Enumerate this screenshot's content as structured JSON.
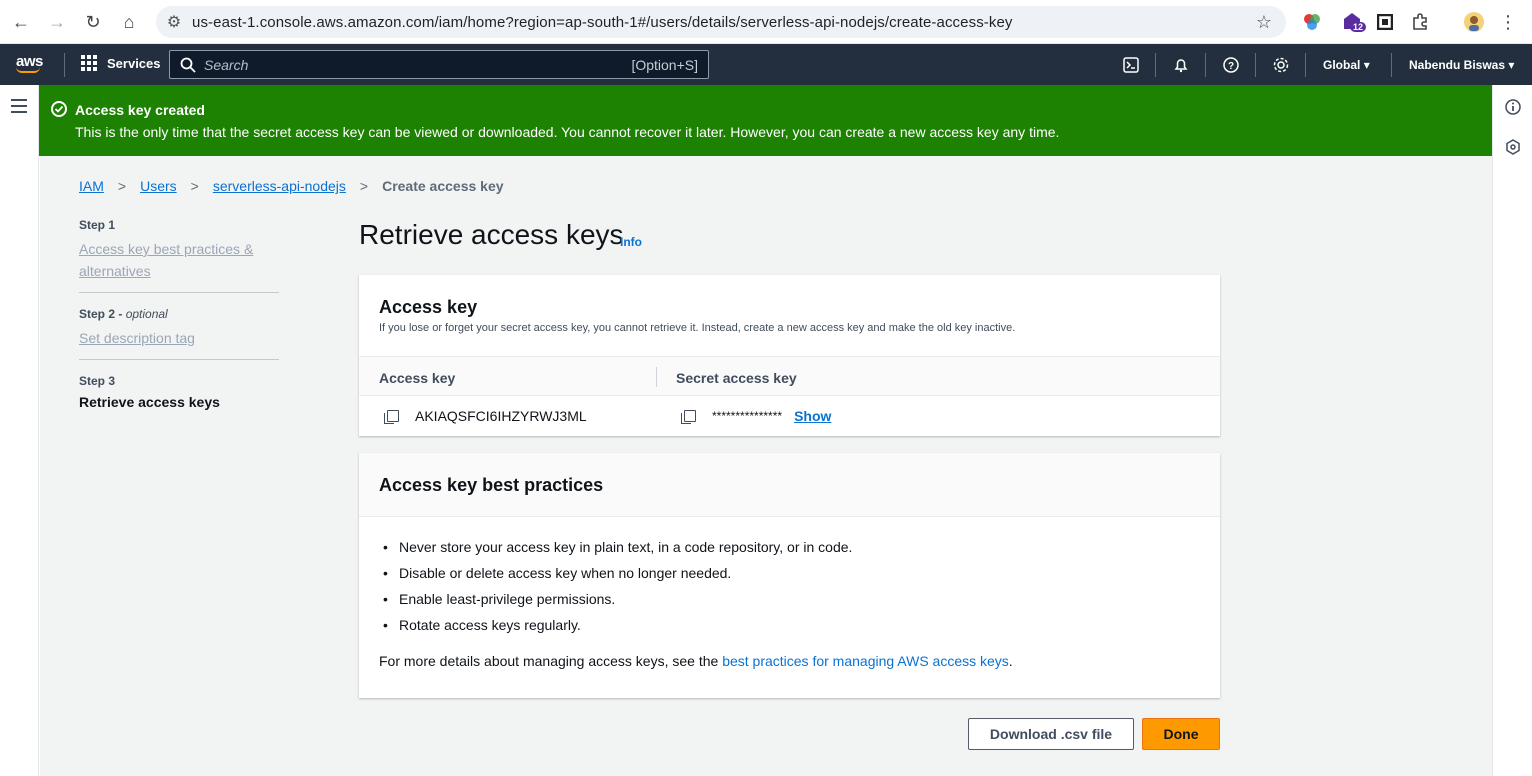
{
  "browser": {
    "url": "us-east-1.console.aws.amazon.com/iam/home?region=ap-south-1#/users/details/serverless-api-nodejs/create-access-key",
    "extension_badge": "12"
  },
  "topnav": {
    "logo": "aws",
    "services_label": "Services",
    "search_placeholder": "Search",
    "search_shortcut": "[Option+S]",
    "region": "Global",
    "user": "Nabendu Biswas"
  },
  "flash": {
    "title": "Access key created",
    "message": "This is the only time that the secret access key can be viewed or downloaded. You cannot recover it later. However, you can create a new access key any time."
  },
  "breadcrumb": {
    "items": [
      "IAM",
      "Users",
      "serverless-api-nodejs"
    ],
    "current": "Create access key"
  },
  "steps": [
    {
      "label": "Step 1",
      "optional": "",
      "title": "Access key best practices & alternatives"
    },
    {
      "label": "Step 2",
      "optional": "optional",
      "title": "Set description tag"
    },
    {
      "label": "Step 3",
      "optional": "",
      "title": "Retrieve access keys"
    }
  ],
  "page": {
    "title": "Retrieve access keys",
    "info": "Info"
  },
  "access_key_panel": {
    "heading": "Access key",
    "description": "If you lose or forget your secret access key, you cannot retrieve it. Instead, create a new access key and make the old key inactive.",
    "col_access_key": "Access key",
    "col_secret": "Secret access key",
    "access_key_value": "AKIAQSFCI6IHZYRWJ3ML",
    "secret_masked": "***************",
    "show_label": "Show"
  },
  "best_practices_panel": {
    "heading": "Access key best practices",
    "items": [
      "Never store your access key in plain text, in a code repository, or in code.",
      "Disable or delete access key when no longer needed.",
      "Enable least-privilege permissions.",
      "Rotate access keys regularly."
    ],
    "more_prefix": "For more details about managing access keys, see the ",
    "more_link": "best practices for managing AWS access keys",
    "more_suffix": "."
  },
  "actions": {
    "download_label": "Download .csv file",
    "done_label": "Done"
  },
  "colors": {
    "aws_nav": "#232f3e",
    "success": "#1d8102",
    "link": "#0972d3",
    "primary_button": "#ff9900"
  }
}
